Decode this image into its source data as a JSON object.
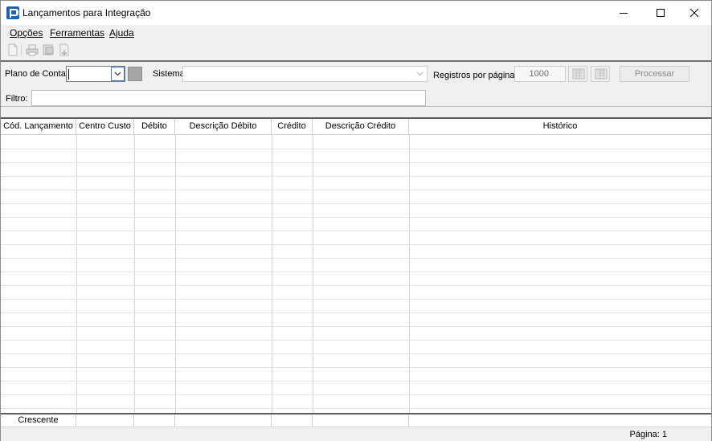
{
  "window": {
    "title": "Lançamentos para Integração",
    "icon": "app-p-icon",
    "controls": [
      "minimize-icon",
      "maximize-icon",
      "close-icon"
    ]
  },
  "menu": {
    "items": [
      {
        "label": "Opções",
        "mnemonic": "O"
      },
      {
        "label": "Ferramentas",
        "mnemonic": "F"
      },
      {
        "label": "Ajuda",
        "mnemonic": "A"
      }
    ]
  },
  "toolbar": {
    "icons": [
      "new-document-icon",
      "print-icon",
      "print-preview-icon",
      "export-icon"
    ]
  },
  "filters": {
    "plano_label": "Plano de Contas",
    "plano_value": "",
    "sistema_label": "Sistema",
    "sistema_value": "",
    "registros_label": "Registros por páginas:",
    "registros_value": "1000",
    "processar_label": "Processar",
    "filtro_label": "Filtro:",
    "filtro_value": ""
  },
  "grid": {
    "columns": [
      "Cód. Lançamento",
      "Centro Custo",
      "Débito",
      "Descrição Débito",
      "Crédito",
      "Descrição Crédito",
      "Histórico"
    ],
    "rows": [],
    "footer": [
      "Crescente",
      "",
      "",
      "",
      "",
      "",
      ""
    ]
  },
  "status": {
    "page_text": "Página: 1"
  },
  "colors": {
    "app_icon": "#1a63b8",
    "grid_border": "#5d5d5d",
    "background": "#f0f0f0"
  }
}
